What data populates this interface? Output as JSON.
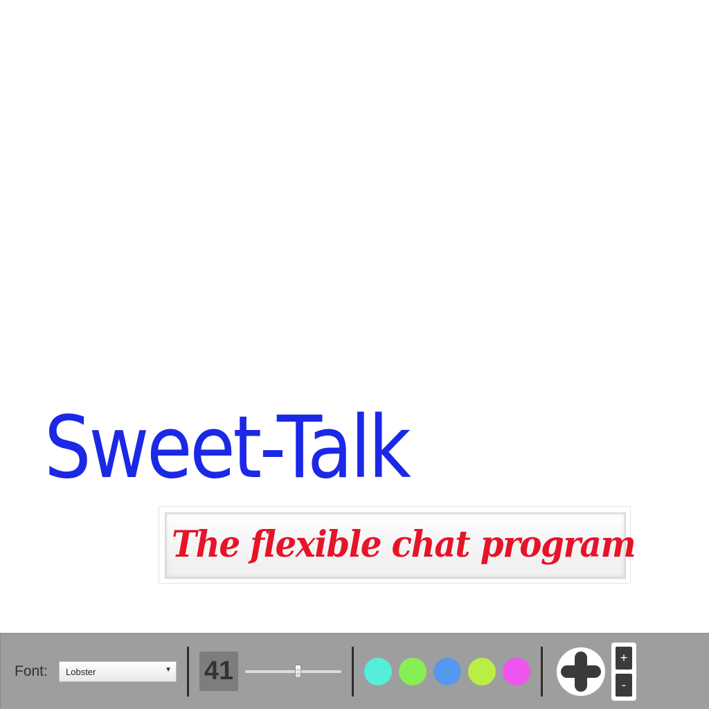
{
  "canvas": {
    "title_text": "Sweet-Talk",
    "tagline_text": "The flexible chat program"
  },
  "toolbar": {
    "font_label": "Font:",
    "font_select_value": "Lobster",
    "font_size_value": "41",
    "font_size_slider_fraction": 0.55,
    "colors": [
      {
        "name": "turquoise",
        "hex": "#55eedd"
      },
      {
        "name": "green",
        "hex": "#88ee55"
      },
      {
        "name": "blue",
        "hex": "#5599ee"
      },
      {
        "name": "lime",
        "hex": "#bbee44"
      },
      {
        "name": "magenta",
        "hex": "#ee55ee"
      }
    ],
    "add_icon": "plus-icon",
    "zoom_in_label": "+",
    "zoom_out_label": "-"
  },
  "accent_colors": {
    "title": "#1b28e6",
    "tagline": "#e51429",
    "toolbar_bg": "#9e9e9e"
  }
}
